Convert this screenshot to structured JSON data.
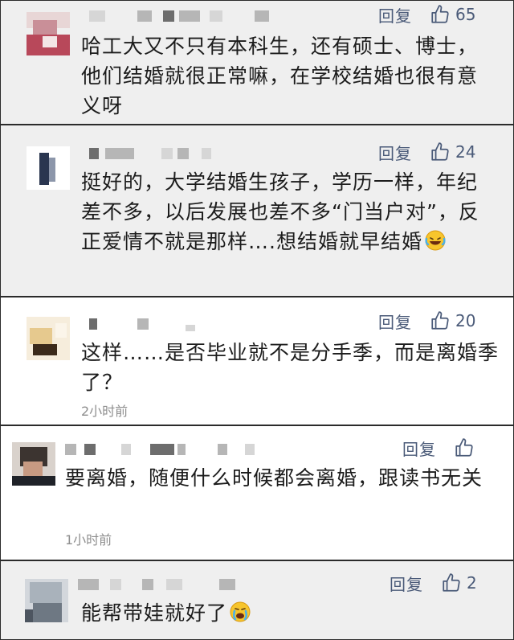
{
  "comments": [
    {
      "reply_label": "回复",
      "like_count": "65",
      "text": "哈工大又不只有本科生，还有硕士、博士，他们结婚就很正常嘛，在学校结婚也很有意义呀",
      "time": ""
    },
    {
      "reply_label": "回复",
      "like_count": "24",
      "text": "挺好的，大学结婚生孩子，学历一样，年纪差不多，以后发展也差不多“门当户对”，反正爱情不就是那样….想结婚就早结婚",
      "time": ""
    },
    {
      "reply_label": "回复",
      "like_count": "20",
      "text": "这样……是否毕业就不是分手季，而是离婚季了？",
      "time": "2小时前"
    },
    {
      "reply_label": "回复",
      "like_count": "",
      "text": "要离婚，随便什么时候都会离婚，跟读书无关",
      "time": "1小时前"
    },
    {
      "reply_label": "回复",
      "like_count": "2",
      "text": "能帮带娃就好了",
      "time": ""
    }
  ],
  "icons": {
    "like": "thumbs-up-icon",
    "emoji": "laughing-tears-emoji"
  },
  "colors": {
    "action_text": "#4a5a78",
    "grey_card": "#efefef",
    "time_text": "#8e8e8e"
  }
}
